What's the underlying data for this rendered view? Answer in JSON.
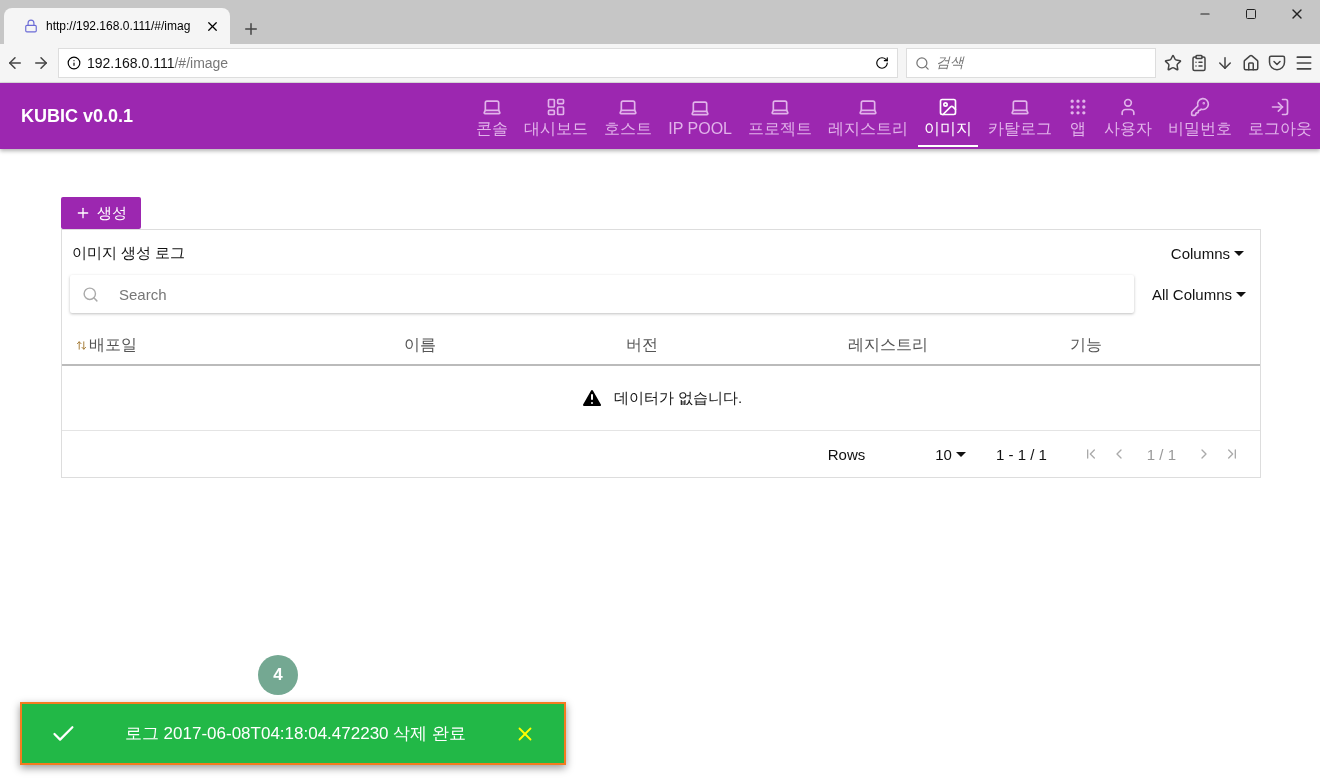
{
  "browser": {
    "tab_title": "http://192.168.0.111/#/imag",
    "url_host": "192.168.0.111",
    "url_path": "/#/image",
    "search_placeholder": "검색"
  },
  "app": {
    "title": "KUBIC v0.0.1",
    "nav": [
      {
        "label": "콘솔",
        "kind": "laptop",
        "selected": false
      },
      {
        "label": "대시보드",
        "kind": "dashboard",
        "selected": false
      },
      {
        "label": "호스트",
        "kind": "laptop",
        "selected": false
      },
      {
        "label": "IP POOL",
        "kind": "laptop",
        "selected": false
      },
      {
        "label": "프로젝트",
        "kind": "laptop",
        "selected": false
      },
      {
        "label": "레지스트리",
        "kind": "laptop",
        "selected": false
      },
      {
        "label": "이미지",
        "kind": "image",
        "selected": true
      },
      {
        "label": "카탈로그",
        "kind": "laptop",
        "selected": false
      },
      {
        "label": "앱",
        "kind": "apps",
        "selected": false
      },
      {
        "label": "사용자",
        "kind": "user",
        "selected": false
      },
      {
        "label": "비밀번호",
        "kind": "key",
        "selected": false
      },
      {
        "label": "로그아웃",
        "kind": "logout",
        "selected": false
      }
    ]
  },
  "create_button": "생성",
  "table": {
    "title": "이미지 생성 로그",
    "columns_menu": "Columns",
    "search_placeholder": "Search",
    "filter": "All Columns",
    "columns": [
      {
        "label": "배포일",
        "sortable": true
      },
      {
        "label": "이름",
        "sortable": false
      },
      {
        "label": "버전",
        "sortable": false
      },
      {
        "label": "레지스트리",
        "sortable": false
      },
      {
        "label": "기능",
        "sortable": false
      }
    ],
    "empty_message": "데이터가 없습니다.",
    "footer": {
      "rows_label": "Rows",
      "rows_per_page": "10",
      "range": "1 - 1 / 1",
      "page": "1 / 1"
    }
  },
  "badge": "4",
  "toast": {
    "message": "로그 2017-06-08T04:18:04.472230 삭제 완료"
  }
}
